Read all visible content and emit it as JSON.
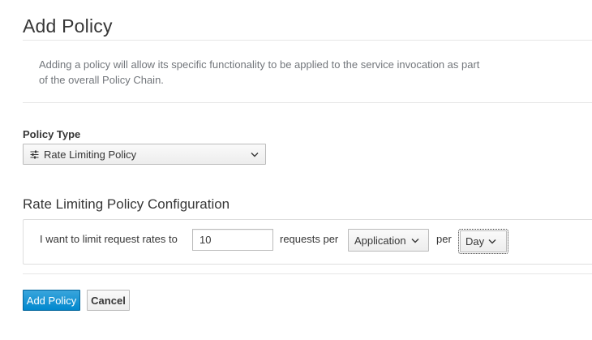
{
  "header": {
    "title": "Add Policy",
    "description": "Adding a policy will allow its specific functionality to be applied to the service invocation as part of the overall Policy Chain."
  },
  "policy_type": {
    "label": "Policy Type",
    "selected": "Rate Limiting Policy",
    "icon": "sliders-icon"
  },
  "config": {
    "title": "Rate Limiting Policy Configuration",
    "prefix_text": "I want to limit request rates to",
    "rate_value": "10",
    "requests_per_text": "requests per",
    "scope_selected": "Application",
    "per_text": "per",
    "period_selected": "Day"
  },
  "actions": {
    "add_label": "Add Policy",
    "cancel_label": "Cancel"
  },
  "colors": {
    "primary": "#0088ce",
    "text": "#363636",
    "muted": "#72767b",
    "border": "#bbbbbb"
  }
}
